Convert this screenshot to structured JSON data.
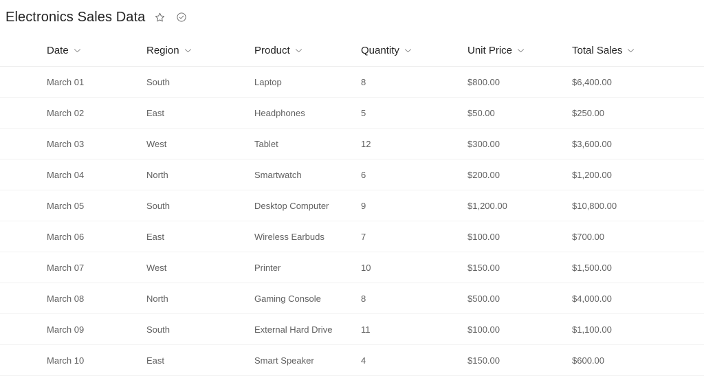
{
  "header": {
    "title": "Electronics Sales Data",
    "favorite_icon": "star-icon",
    "status_icon": "check-circle-icon"
  },
  "table": {
    "columns": [
      {
        "key": "date",
        "label": "Date",
        "sort_icon": "chevron-down-icon"
      },
      {
        "key": "region",
        "label": "Region",
        "sort_icon": "chevron-down-icon"
      },
      {
        "key": "product",
        "label": "Product",
        "sort_icon": "chevron-down-icon"
      },
      {
        "key": "quantity",
        "label": "Quantity",
        "sort_icon": "chevron-down-icon"
      },
      {
        "key": "unit_price",
        "label": "Unit Price",
        "sort_icon": "chevron-down-icon"
      },
      {
        "key": "total_sales",
        "label": "Total Sales",
        "sort_icon": "chevron-down-icon"
      }
    ],
    "rows": [
      {
        "date": "March 01",
        "region": "South",
        "product": "Laptop",
        "quantity": "8",
        "unit_price": "$800.00",
        "total_sales": "$6,400.00"
      },
      {
        "date": "March 02",
        "region": "East",
        "product": "Headphones",
        "quantity": "5",
        "unit_price": "$50.00",
        "total_sales": "$250.00"
      },
      {
        "date": "March 03",
        "region": "West",
        "product": "Tablet",
        "quantity": "12",
        "unit_price": "$300.00",
        "total_sales": "$3,600.00"
      },
      {
        "date": "March 04",
        "region": "North",
        "product": "Smartwatch",
        "quantity": "6",
        "unit_price": "$200.00",
        "total_sales": "$1,200.00"
      },
      {
        "date": "March 05",
        "region": "South",
        "product": "Desktop Computer",
        "quantity": "9",
        "unit_price": "$1,200.00",
        "total_sales": "$10,800.00"
      },
      {
        "date": "March 06",
        "region": "East",
        "product": "Wireless Earbuds",
        "quantity": "7",
        "unit_price": "$100.00",
        "total_sales": "$700.00"
      },
      {
        "date": "March 07",
        "region": "West",
        "product": "Printer",
        "quantity": "10",
        "unit_price": "$150.00",
        "total_sales": "$1,500.00"
      },
      {
        "date": "March 08",
        "region": "North",
        "product": "Gaming Console",
        "quantity": "8",
        "unit_price": "$500.00",
        "total_sales": "$4,000.00"
      },
      {
        "date": "March 09",
        "region": "South",
        "product": "External Hard Drive",
        "quantity": "11",
        "unit_price": "$100.00",
        "total_sales": "$1,100.00"
      },
      {
        "date": "March 10",
        "region": "East",
        "product": "Smart Speaker",
        "quantity": "4",
        "unit_price": "$150.00",
        "total_sales": "$600.00"
      }
    ]
  },
  "colors": {
    "title_text": "#242424",
    "header_text": "#242424",
    "cell_text": "#616161",
    "row_divider": "#f2f2f2",
    "header_divider": "#ededed",
    "icon_stroke": "#616161",
    "background": "#ffffff"
  }
}
